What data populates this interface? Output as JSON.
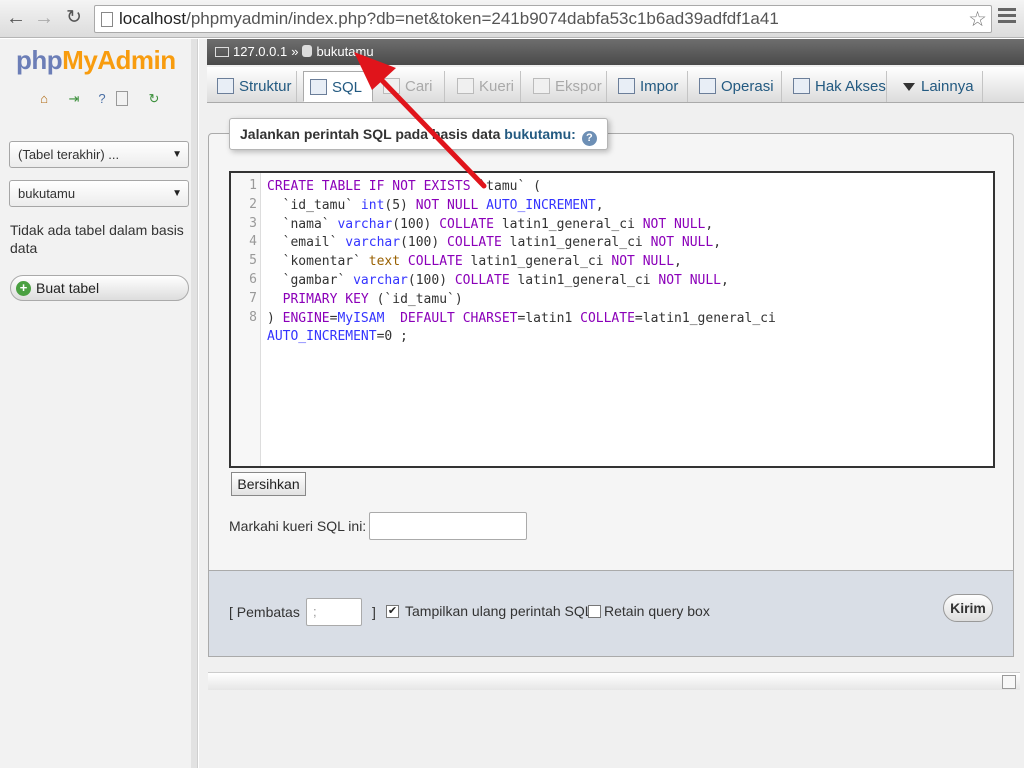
{
  "browser": {
    "url_host": "localhost",
    "url_path": "/phpmyadmin/index.php?db=net&token=241b9074dabfa53c1b6ad39adfdf1a41",
    "nav_back": "←",
    "nav_forward": "→",
    "nav_reload": "↻",
    "star": "☆"
  },
  "sidebar": {
    "logo_php": "php",
    "logo_myadmin": "MyAdmin",
    "quick_icons": [
      "home-icon",
      "exit-icon",
      "help-icon",
      "docs-icon",
      "reload-icon"
    ],
    "recent_tables_select": "(Tabel terakhir) ...",
    "database_select": "bukutamu",
    "no_tables_text": "Tidak ada tabel dalam basis data",
    "create_table_button": "Buat tabel"
  },
  "breadcrumb": {
    "server": "127.0.0.1",
    "separator": "»",
    "database": "bukutamu"
  },
  "tabs": [
    {
      "label": "Struktur",
      "state": "normal"
    },
    {
      "label": "SQL",
      "state": "active"
    },
    {
      "label": "Cari",
      "state": "disabled"
    },
    {
      "label": "Kueri",
      "state": "disabled"
    },
    {
      "label": "Ekspor",
      "state": "disabled"
    },
    {
      "label": "Impor",
      "state": "normal"
    },
    {
      "label": "Operasi",
      "state": "normal"
    },
    {
      "label": "Hak Akses",
      "state": "normal"
    },
    {
      "label": "Lainnya",
      "state": "normal"
    }
  ],
  "sql_panel": {
    "legend_prefix": "Jalankan perintah SQL pada basis data",
    "legend_db": "bukutamu:",
    "help_icon": "?",
    "line_numbers": [
      "1",
      "2",
      "3",
      "4",
      "5",
      "6",
      "7",
      "8"
    ],
    "code_lines": [
      "CREATE TABLE IF NOT EXISTS `tamu` (",
      "  `id_tamu` int(5) NOT NULL AUTO_INCREMENT,",
      "  `nama` varchar(100) COLLATE latin1_general_ci NOT NULL,",
      "  `email` varchar(100) COLLATE latin1_general_ci NOT NULL,",
      "  `komentar` text COLLATE latin1_general_ci NOT NULL,",
      "  `gambar` varchar(100) COLLATE latin1_general_ci NOT NULL,",
      "  PRIMARY KEY (`id_tamu`)",
      ") ENGINE=MyISAM  DEFAULT CHARSET=latin1 COLLATE=latin1_general_ci",
      "AUTO_INCREMENT=0 ;"
    ],
    "clear_button": "Bersihkan",
    "bookmark_label": "Markahi kueri SQL ini:",
    "bookmark_value": ""
  },
  "footer": {
    "delimiter_label": "[ Pembatas",
    "delimiter_value": ";",
    "delimiter_close": "]",
    "show_query_label": "Tampilkan ulang perintah SQL",
    "show_query_checked": true,
    "retain_box_label": "Retain query box",
    "retain_box_checked": false,
    "submit_button": "Kirim"
  },
  "colors": {
    "annotation_arrow": "#e0141b",
    "link_blue": "#235a81",
    "sql_keyword": "#8b00b9",
    "sql_type": "#3434ff",
    "logo_orange": "#f89c0e"
  }
}
